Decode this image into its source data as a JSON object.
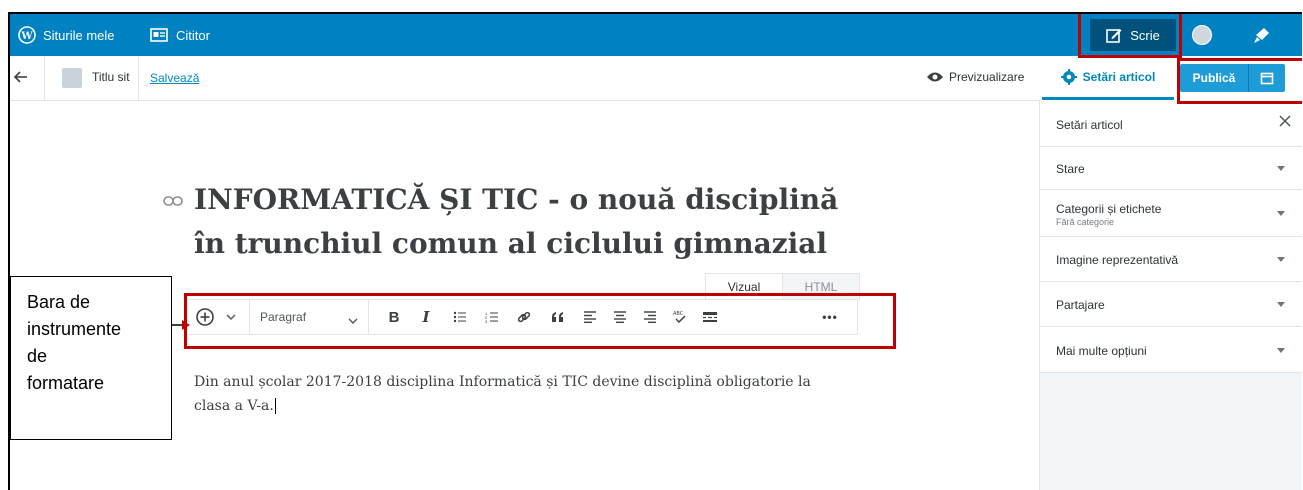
{
  "topbar": {
    "my_sites": "Siturile mele",
    "reader": "Cititor",
    "write": "Scrie"
  },
  "editor_bar": {
    "site_title": "Titlu sit",
    "save": "Salvează",
    "preview": "Previzualizare",
    "settings_tab": "Setări articol",
    "publish": "Publică"
  },
  "sidebar": {
    "title": "Setări articol",
    "panels": [
      {
        "label": "Stare"
      },
      {
        "label": "Categorii și etichete",
        "sub": "Fără categorie"
      },
      {
        "label": "Imagine reprezentativă"
      },
      {
        "label": "Partajare"
      },
      {
        "label": "Mai multe opțiuni"
      }
    ]
  },
  "post": {
    "title": "INFORMATICĂ ȘI TIC - o nouă disciplină în trunchiul comun al ciclului gimnazial",
    "body": "Din anul școlar 2017-2018 disciplina Informatică și TIC devine disciplină obligatorie la clasa a V-a."
  },
  "mode_tabs": [
    "Vizual",
    "HTML"
  ],
  "toolbar": {
    "paragraph": "Paragraf",
    "bold": "B",
    "italic": "I",
    "more": "•••"
  },
  "annotation": {
    "lines": [
      "Bara de",
      "instrumente",
      "de",
      "formatare"
    ]
  },
  "colors": {
    "topbar": "#0081c2",
    "highlight": "#c00000",
    "accent": "#0087be"
  }
}
